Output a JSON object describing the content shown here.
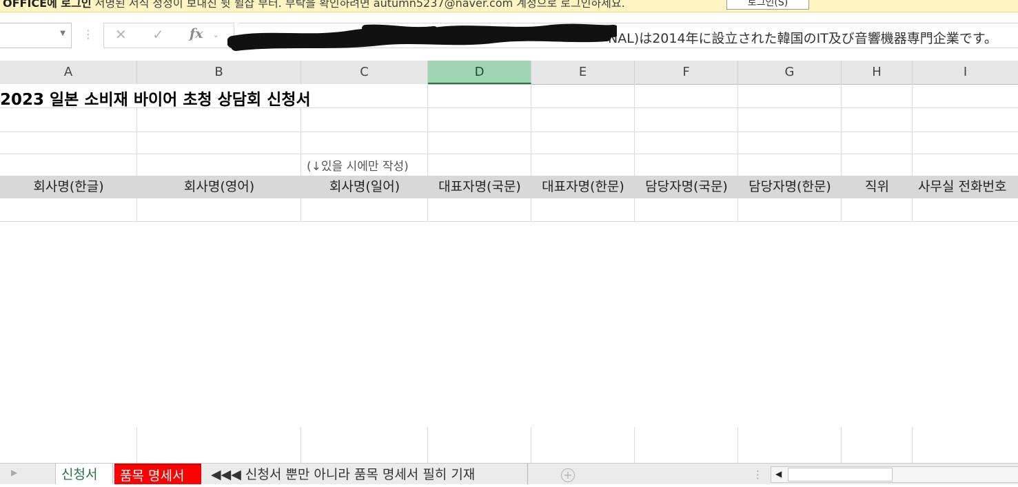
{
  "notification": {
    "text_bold": "OFFICE에 로그인",
    "text": "서명된 서식 정정이 보내진 뒷 뮐샵 부터. 부탁을 확인하려면 autumn5237@naver.com 계정으로 로그인하세요.",
    "button_label": "로그인(S)"
  },
  "formula_bar": {
    "name_box_value": "",
    "cancel_icon": "✕",
    "enter_icon": "✓",
    "fx_label": "fx",
    "formula_visible_text": "NAL)は2014年に設立された韓国のIT及び音響機器専門企業です。"
  },
  "columns": [
    "A",
    "B",
    "C",
    "D",
    "E",
    "F",
    "G",
    "H",
    "I"
  ],
  "selected_column": "D",
  "sheet": {
    "title": "2023 일본 소비재 바이어 초청 상담회 신청서",
    "note": "(↓있을 시에만 작성)",
    "header_cells": [
      "회사명(한글)",
      "회사명(영어)",
      "회사명(일어)",
      "대표자명(국문)",
      "대표자명(한문)",
      "담당자명(국문)",
      "담당자명(한문)",
      "직위",
      "사무실 전화번호"
    ]
  },
  "tabs": {
    "active": "신청서",
    "red": "품목 명세서",
    "warning": "◀◀◀ 신청서 뿐만 아니라 품목 명세서 필히 기재",
    "add_symbol": "+"
  }
}
